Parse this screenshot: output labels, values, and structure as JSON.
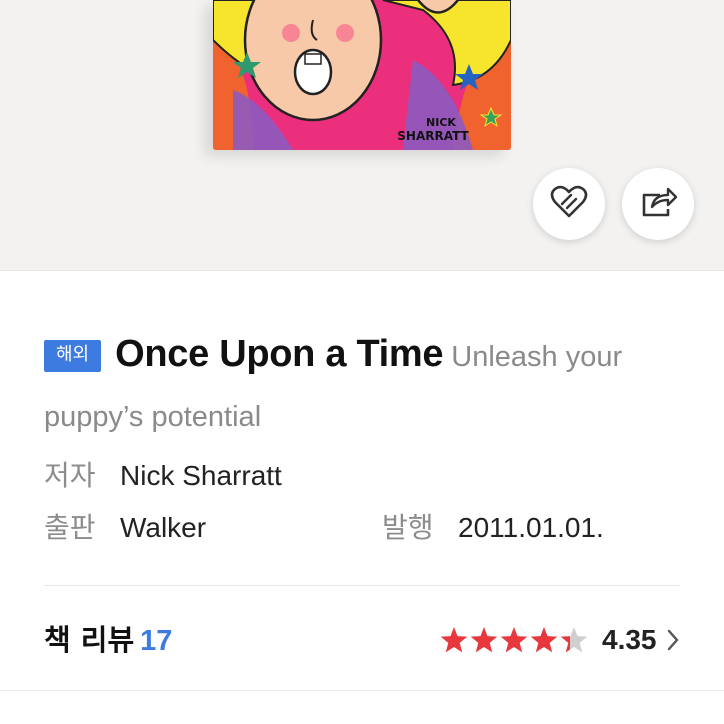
{
  "book": {
    "badge": "해외",
    "title": "Once Upon a Time",
    "subtitle": "Unleash your puppy’s potential",
    "cover_text_line1": "NICK",
    "cover_text_line2": "SHARRATT"
  },
  "meta": {
    "author_label": "저자",
    "author": "Nick Sharratt",
    "publisher_label": "출판",
    "publisher": "Walker",
    "date_label": "발행",
    "date": "2011.01.01."
  },
  "review": {
    "label": "책 리뷰",
    "count": "17",
    "rating": "4.35",
    "rating_value": 4.35,
    "rating_max": 5,
    "star_color": "#e8383d",
    "star_empty_color": "#cfcfcf"
  },
  "icons": {
    "like": "heart-icon",
    "share": "share-icon",
    "more": "chevron-right-icon"
  },
  "colors": {
    "badge": "#3d7be0",
    "cover_pink": "#ec2f7d",
    "cover_yellow": "#f7e42c"
  }
}
